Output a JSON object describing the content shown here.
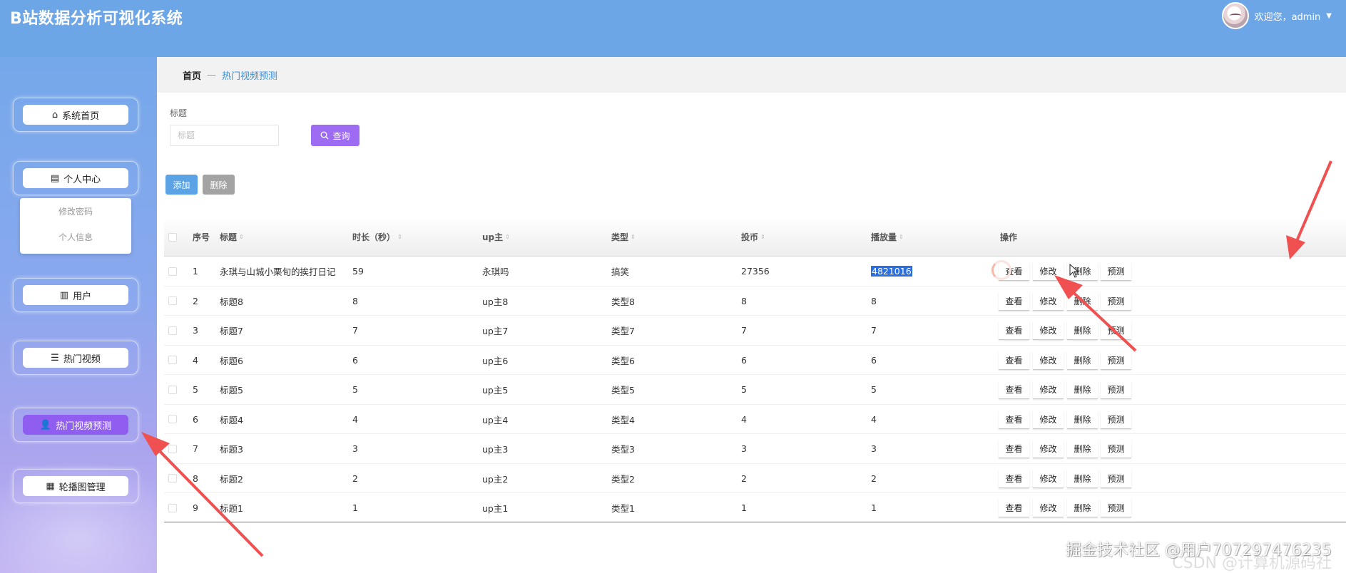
{
  "header": {
    "title": "B站数据分析可视化系统",
    "greeting": "欢迎您，admin",
    "caret": "▼"
  },
  "sidebar": {
    "items": [
      {
        "label": "系统首页",
        "icon": "home-icon",
        "glyph": "⌂"
      },
      {
        "label": "个人中心",
        "icon": "calendar-icon",
        "glyph": "▤"
      },
      {
        "label": "用户",
        "icon": "library-icon",
        "glyph": "▥"
      },
      {
        "label": "热门视频",
        "icon": "list-icon",
        "glyph": "☰"
      },
      {
        "label": "热门视频预测",
        "icon": "user-icon",
        "glyph": "👤",
        "active": true
      },
      {
        "label": "轮播图管理",
        "icon": "grid-icon",
        "glyph": "▦"
      }
    ],
    "submenu": [
      "修改密码",
      "个人信息"
    ]
  },
  "breadcrumb": {
    "home": "首页",
    "separator": "—",
    "current": "热门视频预测"
  },
  "search": {
    "label": "标题",
    "placeholder": "标题",
    "value": "",
    "button": "查询"
  },
  "actions": {
    "add": "添加",
    "delete": "删除"
  },
  "table": {
    "columns": [
      "序号",
      "标题",
      "时长（秒）",
      "up主",
      "类型",
      "投币",
      "播放量",
      "操作"
    ],
    "row_buttons": [
      "查看",
      "修改",
      "删除",
      "预测"
    ],
    "rows": [
      {
        "no": "1",
        "title": "永琪与山城小栗旬的挨打日记",
        "duration": "59",
        "up": "永琪吗",
        "type": "搞笑",
        "coins": "27356",
        "plays": "4821016",
        "selected": true
      },
      {
        "no": "2",
        "title": "标题8",
        "duration": "8",
        "up": "up主8",
        "type": "类型8",
        "coins": "8",
        "plays": "8"
      },
      {
        "no": "3",
        "title": "标题7",
        "duration": "7",
        "up": "up主7",
        "type": "类型7",
        "coins": "7",
        "plays": "7"
      },
      {
        "no": "4",
        "title": "标题6",
        "duration": "6",
        "up": "up主6",
        "type": "类型6",
        "coins": "6",
        "plays": "6"
      },
      {
        "no": "5",
        "title": "标题5",
        "duration": "5",
        "up": "up主5",
        "type": "类型5",
        "coins": "5",
        "plays": "5"
      },
      {
        "no": "6",
        "title": "标题4",
        "duration": "4",
        "up": "up主4",
        "type": "类型4",
        "coins": "4",
        "plays": "4"
      },
      {
        "no": "7",
        "title": "标题3",
        "duration": "3",
        "up": "up主3",
        "type": "类型3",
        "coins": "3",
        "plays": "3"
      },
      {
        "no": "8",
        "title": "标题2",
        "duration": "2",
        "up": "up主2",
        "type": "类型2",
        "coins": "2",
        "plays": "2"
      },
      {
        "no": "9",
        "title": "标题1",
        "duration": "1",
        "up": "up主1",
        "type": "类型1",
        "coins": "1",
        "plays": "1"
      }
    ]
  },
  "watermark": "掘金技术社区 @用户707297476235",
  "watermark_ghost": "CSDN @计算机源码社",
  "colors": {
    "header": "#6da6e6",
    "active_menu": "#8f5ef0",
    "query_button": "#9d6cf2",
    "add_button": "#5ca3e6",
    "annotation_arrow": "#f05050"
  }
}
